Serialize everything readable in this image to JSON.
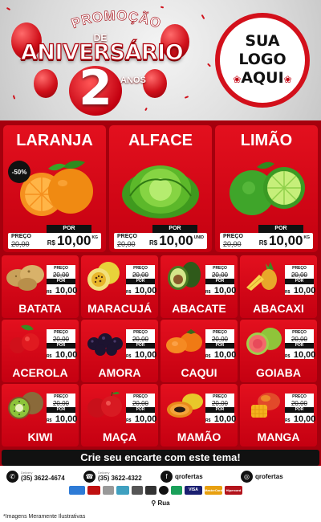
{
  "header": {
    "promo": "PROMOÇÃO",
    "de": "DE",
    "aniversario": "ANIVERSÁRIO",
    "number": "2",
    "anos": "ANOS",
    "logo": {
      "line1": "SUA",
      "line2": "LOGO",
      "line3": "AQUI"
    }
  },
  "featured": [
    {
      "name": "LARANJA",
      "preco_label": "PREÇO",
      "old": "20,00",
      "por_label": "POR",
      "currency": "R$",
      "new": "10,00",
      "unit": "KG",
      "discount": "-50%"
    },
    {
      "name": "ALFACE",
      "preco_label": "PREÇO",
      "old": "20,00",
      "por_label": "POR",
      "currency": "R$",
      "new": "10,00",
      "unit": "UNID"
    },
    {
      "name": "LIMÃO",
      "preco_label": "PREÇO",
      "old": "20,00",
      "por_label": "POR",
      "currency": "R$",
      "new": "10,00",
      "unit": "KG"
    }
  ],
  "products": [
    {
      "name": "BATATA",
      "preco_label": "PREÇO",
      "old": "20,00",
      "por_label": "POR",
      "currency": "R$",
      "new": "10,00"
    },
    {
      "name": "MARACUJÁ",
      "preco_label": "PREÇO",
      "old": "20,00",
      "por_label": "POR",
      "currency": "R$",
      "new": "10,00"
    },
    {
      "name": "ABACATE",
      "preco_label": "PREÇO",
      "old": "20,00",
      "por_label": "POR",
      "currency": "R$",
      "new": "10,00"
    },
    {
      "name": "ABACAXI",
      "preco_label": "PREÇO",
      "old": "20,00",
      "por_label": "POR",
      "currency": "R$",
      "new": "10,00"
    },
    {
      "name": "ACEROLA",
      "preco_label": "PREÇO",
      "old": "20,00",
      "por_label": "POR",
      "currency": "R$",
      "new": "10,00"
    },
    {
      "name": "AMORA",
      "preco_label": "PREÇO",
      "old": "20,00",
      "por_label": "POR",
      "currency": "R$",
      "new": "10,00"
    },
    {
      "name": "CAQUI",
      "preco_label": "PREÇO",
      "old": "20,00",
      "por_label": "POR",
      "currency": "R$",
      "new": "10,00"
    },
    {
      "name": "GOIABA",
      "preco_label": "PREÇO",
      "old": "20,00",
      "por_label": "POR",
      "currency": "R$",
      "new": "10,00"
    },
    {
      "name": "KIWI",
      "preco_label": "PREÇO",
      "old": "20,00",
      "por_label": "POR",
      "currency": "R$",
      "new": "10,00"
    },
    {
      "name": "MAÇA",
      "preco_label": "PREÇO",
      "old": "20,00",
      "por_label": "POR",
      "currency": "R$",
      "new": "10,00"
    },
    {
      "name": "MAMÃO",
      "preco_label": "PREÇO",
      "old": "20,00",
      "por_label": "POR",
      "currency": "R$",
      "new": "10,00"
    },
    {
      "name": "MANGA",
      "preco_label": "PREÇO",
      "old": "20,00",
      "por_label": "POR",
      "currency": "R$",
      "new": "10,00"
    }
  ],
  "cta": "Crie seu encarte com este tema!",
  "contacts": {
    "phone1_label": "Delivery",
    "phone1": "(35) 3622-4674",
    "phone2_label": "Delivery",
    "phone2": "(35) 3622-4322",
    "facebook": "qrofertas",
    "instagram": "qrofertas"
  },
  "payments": [
    "VISA",
    "MasterCard",
    "Hipercard"
  ],
  "address": "Rua",
  "disclaimer": "*Imagens Meramente Ilustrativas",
  "colors": {
    "primary_red": "#d3101b",
    "dark_red": "#a5000d",
    "black": "#111111"
  }
}
